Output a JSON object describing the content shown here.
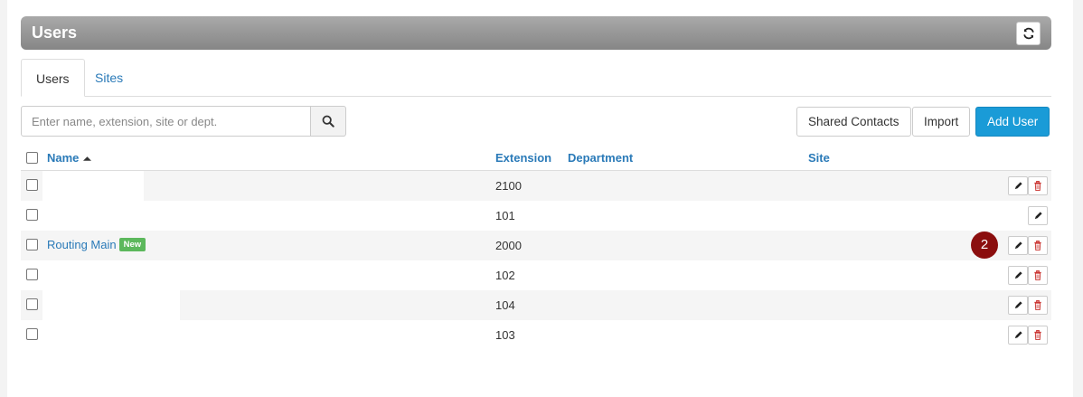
{
  "header": {
    "title": "Users",
    "refresh_icon": "refresh-icon"
  },
  "tabs": [
    {
      "label": "Users",
      "active": true
    },
    {
      "label": "Sites",
      "active": false
    }
  ],
  "search": {
    "placeholder": "Enter name, extension, site or dept.",
    "value": "",
    "icon": "search-icon"
  },
  "toolbar": {
    "shared_contacts_label": "Shared Contacts",
    "import_label": "Import",
    "add_user_label": "Add User"
  },
  "table": {
    "columns": {
      "name": "Name",
      "extension": "Extension",
      "department": "Department",
      "site": "Site"
    },
    "sort": {
      "column": "Name",
      "direction": "asc"
    },
    "rows": [
      {
        "name": "",
        "badge": "",
        "extension": "2100",
        "department": "",
        "site": "",
        "actions": [
          "edit",
          "delete"
        ]
      },
      {
        "name": "",
        "badge": "",
        "extension": "101",
        "department": "",
        "site": "",
        "actions": [
          "edit"
        ]
      },
      {
        "name": "Routing Main",
        "badge": "New",
        "extension": "2000",
        "department": "",
        "site": "",
        "actions": [
          "edit",
          "delete"
        ]
      },
      {
        "name": "",
        "badge": "",
        "extension": "102",
        "department": "",
        "site": "",
        "actions": [
          "edit",
          "delete"
        ]
      },
      {
        "name": "",
        "badge": "",
        "extension": "104",
        "department": "",
        "site": "",
        "actions": [
          "edit",
          "delete"
        ]
      },
      {
        "name": "",
        "badge": "",
        "extension": "103",
        "department": "",
        "site": "",
        "actions": [
          "edit",
          "delete"
        ]
      }
    ]
  },
  "annotation": {
    "step_number": "2"
  },
  "colors": {
    "link": "#2a7ab8",
    "primary_button": "#1a9bd7",
    "badge_new": "#5cb85c",
    "delete_icon": "#c9302c",
    "step_marker": "#8b0e0e"
  }
}
